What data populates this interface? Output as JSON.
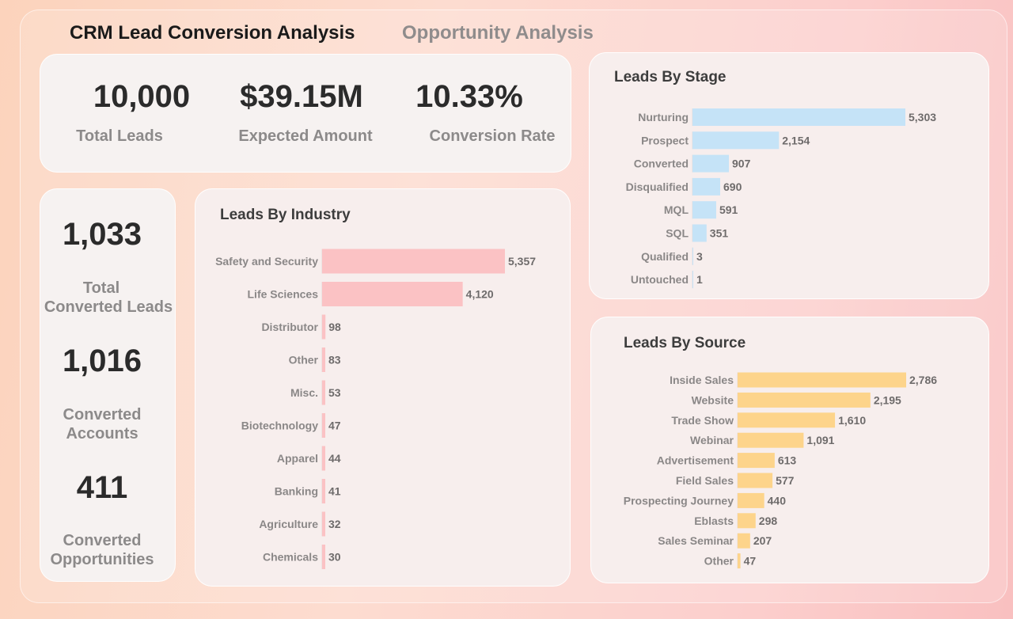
{
  "tabs": {
    "active": "CRM Lead Conversion Analysis",
    "inactive": "Opportunity Analysis"
  },
  "kpis": {
    "total_leads": {
      "value": "10,000",
      "label": "Total Leads"
    },
    "expected_amount": {
      "value": "$39.15M",
      "label": "Expected Amount"
    },
    "conversion_rate": {
      "value": "10.33%",
      "label": "Conversion Rate"
    }
  },
  "side_kpis": {
    "converted_leads": {
      "value": "1,033",
      "label_line1": "Total",
      "label_line2": "Converted Leads"
    },
    "converted_accounts": {
      "value": "1,016",
      "label_line1": "Converted",
      "label_line2": "Accounts"
    },
    "converted_opportunities": {
      "value": "411",
      "label_line1": "Converted",
      "label_line2": "Opportunities"
    }
  },
  "colors": {
    "industry_bar": "#fbc2c4",
    "stage_bar": "#c5e3f7",
    "source_bar": "#fdd48b",
    "label_text": "#8a8787",
    "value_text": "#6e6b6b"
  },
  "chart_data": [
    {
      "id": "industry",
      "type": "bar",
      "orientation": "horizontal",
      "title": "Leads By Industry",
      "categories": [
        "Safety and Security",
        "Life Sciences",
        "Distributor",
        "Other",
        "Misc.",
        "Biotechnology",
        "Apparel",
        "Banking",
        "Agriculture",
        "Chemicals"
      ],
      "values": [
        5357,
        4120,
        98,
        83,
        53,
        47,
        44,
        41,
        32,
        30
      ],
      "value_labels": [
        "5,357",
        "4,120",
        "98",
        "83",
        "53",
        "47",
        "44",
        "41",
        "32",
        "30"
      ],
      "xlim": [
        0,
        5357
      ]
    },
    {
      "id": "stage",
      "type": "bar",
      "orientation": "horizontal",
      "title": "Leads By Stage",
      "categories": [
        "Nurturing",
        "Prospect",
        "Converted",
        "Disqualified",
        "MQL",
        "SQL",
        "Qualified",
        "Untouched"
      ],
      "values": [
        5303,
        2154,
        907,
        690,
        591,
        351,
        3,
        1
      ],
      "value_labels": [
        "5,303",
        "2,154",
        "907",
        "690",
        "591",
        "351",
        "3",
        "1"
      ],
      "xlim": [
        0,
        5303
      ]
    },
    {
      "id": "source",
      "type": "bar",
      "orientation": "horizontal",
      "title": "Leads By Source",
      "categories": [
        "Inside Sales",
        "Website",
        "Trade Show",
        "Webinar",
        "Advertisement",
        "Field Sales",
        "Prospecting Journey",
        "Eblasts",
        "Sales Seminar",
        "Other"
      ],
      "values": [
        2786,
        2195,
        1610,
        1091,
        613,
        577,
        440,
        298,
        207,
        47
      ],
      "value_labels": [
        "2,786",
        "2,195",
        "1,610",
        "1,091",
        "613",
        "577",
        "440",
        "298",
        "207",
        "47"
      ],
      "xlim": [
        0,
        2786
      ]
    }
  ]
}
